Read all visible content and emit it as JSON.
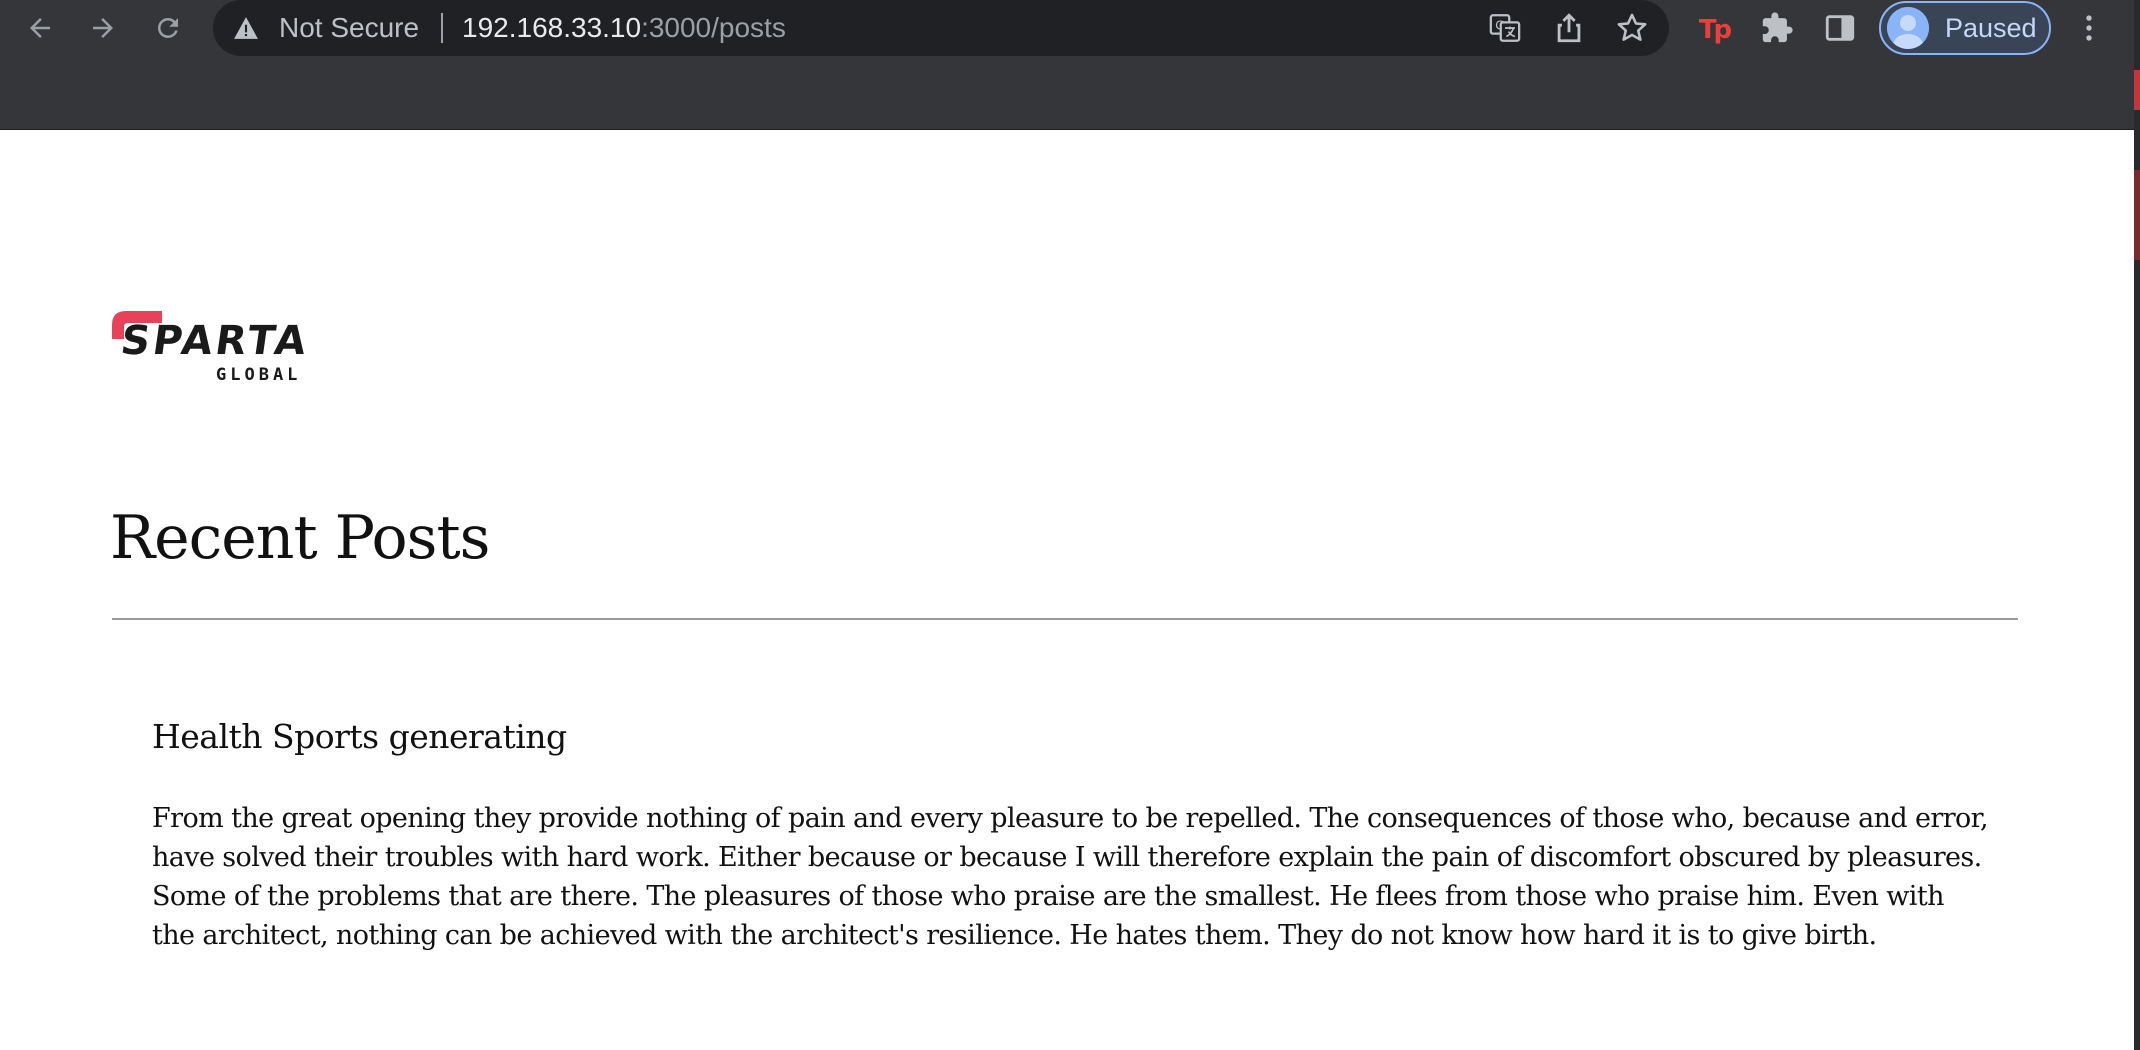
{
  "browser": {
    "omnibox": {
      "security_label": "Not Secure",
      "url_host": "192.168.33.10",
      "url_rest": ":3000/posts"
    },
    "profile": {
      "status": "Paused"
    },
    "extension_label": "Tp",
    "colors": {
      "extension": "#e8403a",
      "profile_accent": "#8ab4f8",
      "chrome_bg": "#35363a"
    }
  },
  "page": {
    "logo": {
      "line1": "SPARTA",
      "line2": "GLOBAL",
      "accent_color": "#e8415a"
    },
    "heading": "Recent Posts",
    "posts": [
      {
        "title": "Health Sports generating",
        "body": "From the great opening they provide nothing of pain and every pleasure to be repelled. The consequences of those who, because and error, have solved their troubles with hard work. Either because or because I will therefore explain the pain of discomfort obscured by pleasures. Some of the problems that are there. The pleasures of those who praise are the smallest. He flees from those who praise him. Even with the architect, nothing can be achieved with the architect's resilience. He hates them. They do not know how hard it is to give birth."
      }
    ]
  }
}
